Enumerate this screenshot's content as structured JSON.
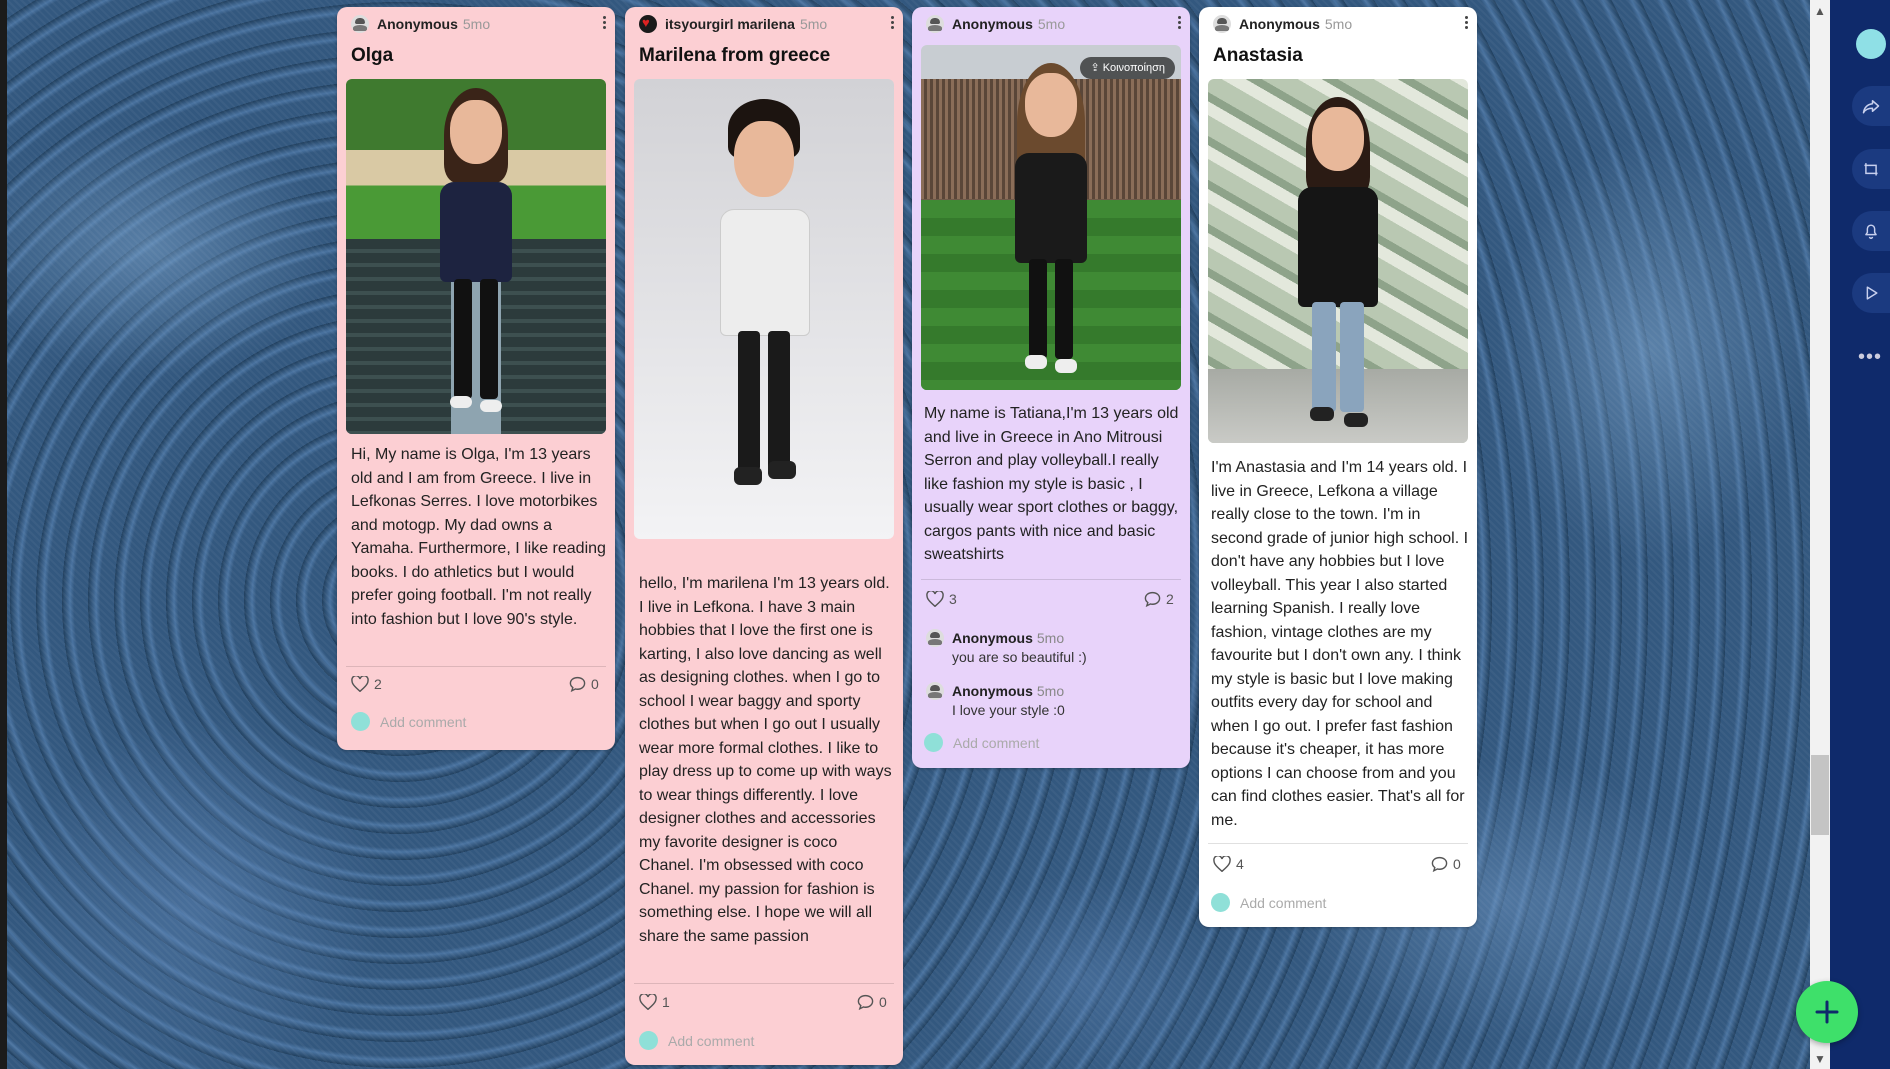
{
  "posts": [
    {
      "author": "Anonymous",
      "time": "5mo",
      "title": "Olga",
      "body": "Hi, My name is Olga, I'm 13 years old and I am from Greece. I live in Lefkonas Serres. I love motorbikes and motogp. My dad owns a Yamaha. Furthermore, I like reading books. I do athletics but I would prefer going football. I'm not really into fashion but I love 90's style.",
      "likes": "2",
      "comments": "0",
      "add_comment": "Add comment",
      "color": "#fccfd3"
    },
    {
      "author": "itsyourgirl marilena",
      "time": "5mo",
      "title": "Marilena from greece",
      "body": "hello, I'm marilena I'm 13 years old. I live in Lefkona. I have 3 main hobbies that I love the first one is karting, I also love dancing as well as designing clothes. when I go to school I wear baggy and sporty clothes but when I go out I usually wear more formal clothes. I like to play dress up to come up with ways to wear things differently. I love designer clothes and accessories my favorite designer is coco Chanel. I'm obsessed with coco Chanel. my passion for fashion is something else. I hope we will all share the same passion",
      "likes": "1",
      "comments": "0",
      "add_comment": "Add comment",
      "color": "#fccfd3"
    },
    {
      "author": "Anonymous",
      "time": "5mo",
      "share_label": "Κοινοποίηση",
      "body": "My name is Tatiana,I'm 13 years old and live in Greece in Ano Mitrousi Serron and play volleyball.I really like fashion my style is basic , I usually wear sport clothes or baggy, cargos pants with nice and basic sweatshirts",
      "likes": "3",
      "comments": "2",
      "comment_list": [
        {
          "author": "Anonymous",
          "time": "5mo",
          "text": "you are so beautiful :)"
        },
        {
          "author": "Anonymous",
          "time": "5mo",
          "text": "I love your style :0"
        }
      ],
      "add_comment": "Add comment",
      "color": "#e8d3fa"
    },
    {
      "author": "Anonymous",
      "time": "5mo",
      "title": "Anastasia",
      "body": "I'm Anastasia and I'm 14 years old. I live in Greece, Lefkona a village really close to the town. I'm in second grade of junior high school. I don't have any hobbies but I love volleyball. This year I also started learning Spanish. I really love fashion, vintage clothes are my favourite but I don't own any. I think my style is basic but I love making outfits every day for school and when I go out. I prefer fast fashion because it's cheaper, it has more options I can choose from and you can find clothes easier. That's all for me.",
      "likes": "4",
      "comments": "0",
      "add_comment": "Add comment",
      "color": "#ffffff"
    }
  ],
  "rail": {
    "icons": [
      "share-icon",
      "remake-icon",
      "bell-icon",
      "slideshow-icon",
      "more-icon"
    ],
    "more_label": "•••"
  },
  "fab_label": "+"
}
